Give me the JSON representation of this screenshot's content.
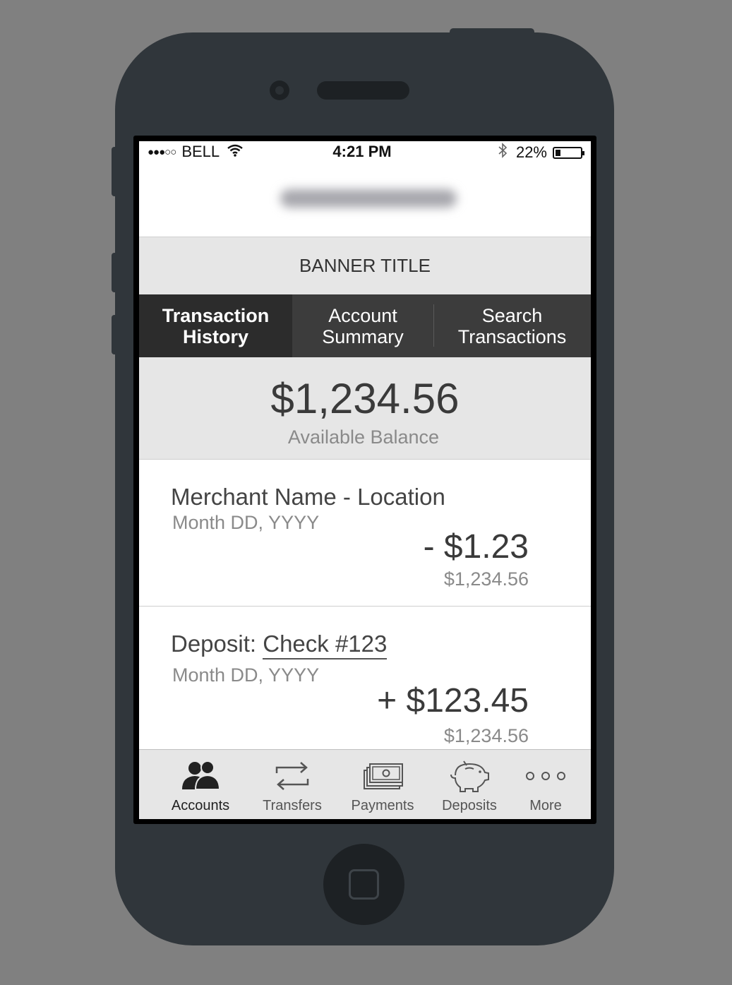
{
  "status_bar": {
    "signal": "●●●○○",
    "carrier": "BELL",
    "time": "4:21 PM",
    "battery_text": "22%",
    "battery_level": 0.22
  },
  "banner": {
    "title": "BANNER TITLE"
  },
  "tabs": [
    {
      "label": "Transaction\nHistory",
      "active": true
    },
    {
      "label": "Account\nSummary",
      "active": false
    },
    {
      "label": "Search\nTransactions",
      "active": false
    }
  ],
  "balance": {
    "amount": "$1,234.56",
    "label": "Available Balance"
  },
  "transactions": [
    {
      "title": "Merchant Name - Location",
      "date": "Month DD, YYYY",
      "amount": "- $1.23",
      "running_balance": "$1,234.56"
    },
    {
      "title_prefix": "Deposit: ",
      "title_link": "Check #123",
      "date": "Month DD, YYYY",
      "amount": "+ $123.45",
      "running_balance": "$1,234.56"
    }
  ],
  "tabbar": {
    "items": [
      {
        "label": "Accounts",
        "icon": "people-icon",
        "active": true
      },
      {
        "label": "Transfers",
        "icon": "transfer-arrows-icon",
        "active": false
      },
      {
        "label": "Payments",
        "icon": "money-stack-icon",
        "active": false
      },
      {
        "label": "Deposits",
        "icon": "piggy-bank-icon",
        "active": false
      },
      {
        "label": "More",
        "icon": "more-dots-icon",
        "active": false
      }
    ]
  },
  "colors": {
    "background": "#808080",
    "device_body": "#30363b",
    "tab_bar_dark": "#3c3c3c",
    "tab_active": "#2c2c2c",
    "panel_gray": "#e6e6e6"
  }
}
